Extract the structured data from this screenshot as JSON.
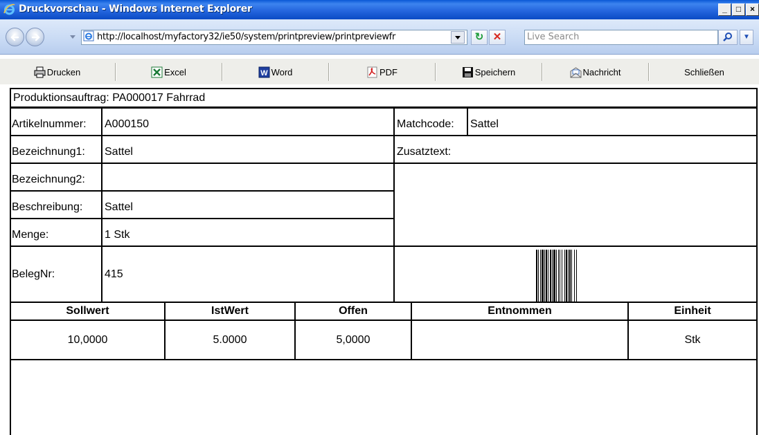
{
  "window": {
    "title": "Druckvorschau - Windows Internet Explorer",
    "controls": {
      "minimize": "_",
      "maximize": "□",
      "close": "×"
    }
  },
  "addressbar": {
    "url": "http://localhost/myfactory32/ie50/system/printpreview/printpreviewfr",
    "search_placeholder": "Live Search"
  },
  "toolbar": {
    "buttons": [
      {
        "label": "Drucken",
        "icon": "printer-icon"
      },
      {
        "label": "Excel",
        "icon": "excel-icon"
      },
      {
        "label": "Word",
        "icon": "word-icon"
      },
      {
        "label": "PDF",
        "icon": "pdf-icon"
      },
      {
        "label": "Speichern",
        "icon": "floppy-disk-icon"
      },
      {
        "label": "Nachricht",
        "icon": "message-icon"
      },
      {
        "label": "Schließen",
        "icon": ""
      }
    ]
  },
  "document": {
    "heading": "Produktionsauftrag:  PA000017  Fahrrad",
    "fields": {
      "artikelnummer_label": "Artikelnummer:",
      "artikelnummer_value": "A000150",
      "matchcode_label": "Matchcode:",
      "matchcode_value": "Sattel",
      "bezeichnung1_label": "Bezeichnung1:",
      "bezeichnung1_value": "Sattel",
      "zusatztext_label": "Zusatztext:",
      "bezeichnung2_label": "Bezeichnung2:",
      "bezeichnung2_value": "",
      "beschreibung_label": "Beschreibung:",
      "beschreibung_value": "Sattel",
      "menge_label": "Menge:",
      "menge_value": "1 Stk",
      "belegnr_label": "BelegNr:",
      "belegnr_value": "415"
    },
    "table": {
      "headers": [
        "Sollwert",
        "IstWert",
        "Offen",
        "Entnommen",
        "Einheit"
      ],
      "rows": [
        [
          "10,0000",
          "5.0000",
          "5,0000",
          "",
          "Stk"
        ]
      ]
    }
  }
}
